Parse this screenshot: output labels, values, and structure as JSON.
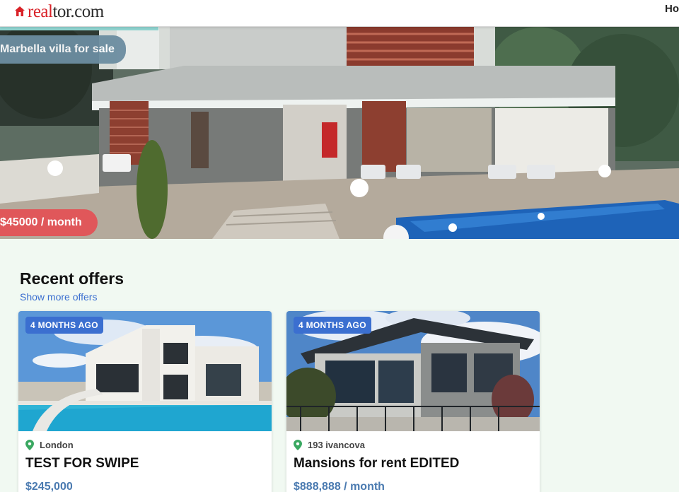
{
  "header": {
    "logo_red": "real",
    "logo_dark": "tor.com",
    "nav_home": "Home"
  },
  "hero": {
    "title": "Marbella villa for sale",
    "price": "$45000 / month"
  },
  "recent": {
    "title": "Recent offers",
    "show_more": "Show more offers"
  },
  "offers": [
    {
      "badge": "4 MONTHS AGO",
      "location": "London",
      "title": "TEST FOR SWIPE",
      "price": "$245,000"
    },
    {
      "badge": "4 MONTHS AGO",
      "location": "193 ivancova",
      "title": "Mansions for rent EDITED",
      "price": "$888,888 / month"
    }
  ],
  "colors": {
    "brand_red": "#d92228",
    "accent_blue": "#3b6fd0",
    "price_blue": "#4a7ab0",
    "page_bg": "#f1f9f2",
    "hero_price_bg": "#e0575a",
    "hero_title_bg": "#6c8da1",
    "pin_green": "#3aa861"
  },
  "icons": [
    "home-logo-icon",
    "location-pin-icon"
  ]
}
